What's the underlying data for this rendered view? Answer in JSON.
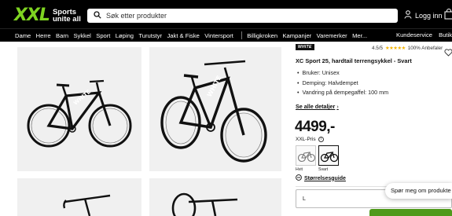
{
  "header": {
    "logo_main": "XXL",
    "logo_tag_1": "Sports",
    "logo_tag_2": "unite all",
    "search_placeholder": "Søk etter produkter",
    "login_label": "Logg inn"
  },
  "nav": {
    "items": [
      "Dame",
      "Herre",
      "Barn",
      "Sykkel",
      "Sport",
      "Løping",
      "Turutstyr",
      "Jakt & Fiske",
      "Vintersport"
    ],
    "items_after_sep": [
      "Billigkroken",
      "Kampanjer",
      "Varemerker",
      "Mer..."
    ],
    "right": [
      "Kundeservice",
      "Butikker"
    ]
  },
  "product": {
    "brand_logo": "WHITE",
    "rating_value": "4.5/5",
    "stars": "★★★★★",
    "recommend": "100% Anbefaler",
    "title": "XC Sport 25, hardtail terrengsykkel - Svart",
    "features": [
      "Bruker: Unisex",
      "Demping: Halvdempet",
      "Vandring på dempegaffel: 100 mm"
    ],
    "details_link": "Se alle detaljer",
    "price": "4499,-",
    "price_label": "XXL-Pris",
    "colors": [
      {
        "label": "Hvit",
        "selected": false
      },
      {
        "label": "Svart",
        "selected": true
      }
    ],
    "size_guide": "Størrelsesguide",
    "size_value": "L"
  },
  "chat": {
    "text": "Spør meg om produkte"
  },
  "colors": {
    "brand_green": "#7ed321",
    "header_bg": "#000000",
    "star": "#f5b400"
  }
}
